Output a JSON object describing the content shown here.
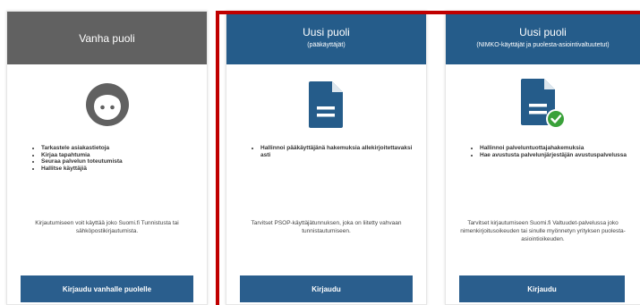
{
  "cards": [
    {
      "title": "Vanha puoli",
      "subtitle": "",
      "icon": "face-icon",
      "bullets": [
        "Tarkastele asiakastietoja",
        "Kirjaa tapahtumia",
        "Seuraa palvelun toteutumista",
        "Hallitse käyttäjiä"
      ],
      "info": "Kirjautumiseen voit käyttää joko Suomi.fi Tunnistusta tai sähköpostikirjautumista.",
      "button": "Kirjaudu vanhalle puolelle"
    },
    {
      "title": "Uusi puoli",
      "subtitle": "(pääkäyttäjät)",
      "icon": "document-icon",
      "bullets": [
        "Hallinnoi pääkäyttäjänä hakemuksia allekirjoitettavaksi asti"
      ],
      "info": "Tarvitset PSOP-käyttäjätunnuksen, joka on liitetty vahvaan tunnistautumiseen.",
      "button": "Kirjaudu"
    },
    {
      "title": "Uusi puoli",
      "subtitle": "(NIMKO-käyttäjät ja puolesta-asiointivaltuutetut)",
      "icon": "document-check-icon",
      "bullets": [
        "Hallinnoi palveluntuottajahakemuksia",
        "Hae avustusta palvelunjärjestäjän avustuspalvelussa"
      ],
      "info": "Tarvitset kirjautumiseen Suomi.fi Valtuudet-palvelussa joko nimenkirjoitusoikeuden tai sinulle myönnetyn yrityksen puolesta-asiointioikeuden.",
      "button": "Kirjaudu"
    }
  ],
  "colors": {
    "old_header": "#616161",
    "new_header": "#255c8a",
    "button": "#2a5e8d",
    "icon": "#255c8a",
    "check": "#3aa13a",
    "highlight": "#c00000"
  }
}
